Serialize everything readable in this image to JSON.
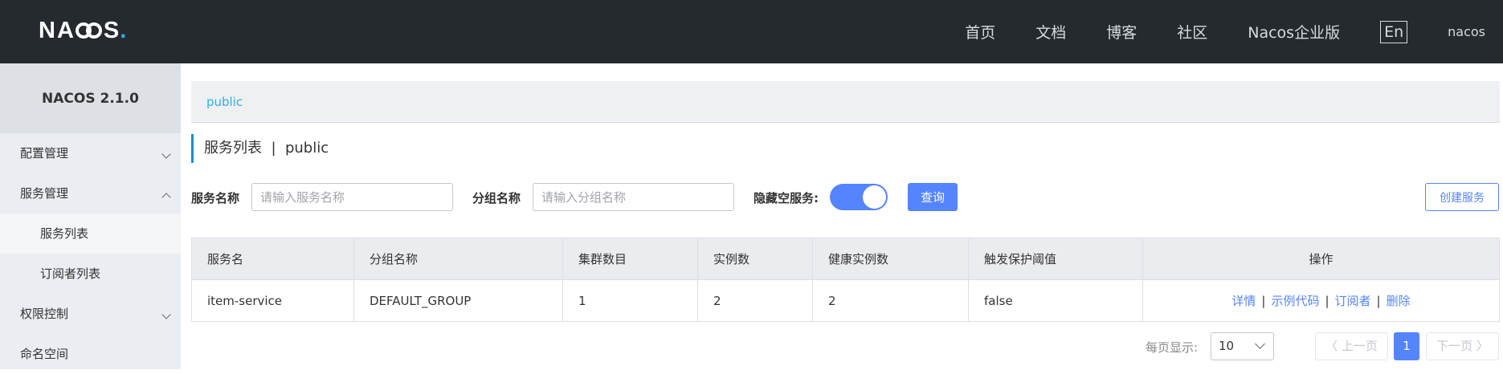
{
  "header": {
    "logo_text": "NACOS.",
    "nav": [
      "首页",
      "文档",
      "博客",
      "社区",
      "Nacos企业版"
    ],
    "lang_button": "En",
    "user": "nacos"
  },
  "sidebar": {
    "version": "NACOS 2.1.0",
    "items": [
      {
        "label": "配置管理"
      },
      {
        "label": "服务管理"
      },
      {
        "label": "服务列表"
      },
      {
        "label": "订阅者列表"
      },
      {
        "label": "权限控制"
      },
      {
        "label": "命名空间"
      }
    ]
  },
  "breadcrumb": "public",
  "page_title": "服务列表  |  public",
  "filters": {
    "service_name_label": "服务名称",
    "service_name_placeholder": "请输入服务名称",
    "group_name_label": "分组名称",
    "group_name_placeholder": "请输入分组名称",
    "hide_empty_label": "隐藏空服务:",
    "hide_empty_on": true,
    "query_button": "查询",
    "create_button": "创建服务"
  },
  "table": {
    "headers": [
      "服务名",
      "分组名称",
      "集群数目",
      "实例数",
      "健康实例数",
      "触发保护阈值",
      "操作"
    ],
    "rows": [
      {
        "service": "item-service",
        "group": "DEFAULT_GROUP",
        "clusters": "1",
        "instances": "2",
        "healthy": "2",
        "threshold": "false",
        "ops": [
          "详情",
          "示例代码",
          "订阅者",
          "删除"
        ]
      }
    ]
  },
  "pagination": {
    "page_size_label": "每页显示:",
    "page_size": "10",
    "prev": "上一页",
    "current": "1",
    "next": "下一页"
  },
  "colors": {
    "topbar": "#252a2f",
    "primary": "#5584ff",
    "link": "#2eb0e0",
    "sidebar": "#eaedf1"
  }
}
